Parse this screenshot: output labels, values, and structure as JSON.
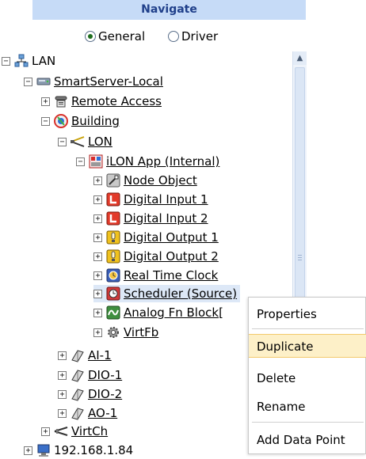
{
  "header": {
    "title": "Navigate"
  },
  "mode": {
    "options": [
      "General",
      "Driver"
    ],
    "selected": "General"
  },
  "tree": [
    {
      "label": "LAN",
      "toggle": "−",
      "icon": "network-icon",
      "underline": false
    },
    {
      "label": "SmartServer-Local",
      "toggle": "−",
      "icon": "server-device-icon",
      "underline": true
    },
    {
      "label": "Remote Access",
      "toggle": "+",
      "icon": "telephone-icon",
      "underline": true
    },
    {
      "label": "Building",
      "toggle": "−",
      "icon": "building-logo-icon",
      "underline": true
    },
    {
      "label": "LON",
      "toggle": "−",
      "icon": "lon-network-icon",
      "underline": true
    },
    {
      "label": "iLON App (Internal)",
      "toggle": "−",
      "icon": "app-icon",
      "underline": true
    },
    {
      "label": "Node Object",
      "toggle": "+",
      "icon": "node-object-icon",
      "underline": true
    },
    {
      "label": "Digital Input 1",
      "toggle": "+",
      "icon": "digital-input-icon",
      "underline": true
    },
    {
      "label": "Digital Input 2",
      "toggle": "+",
      "icon": "digital-input-icon",
      "underline": true
    },
    {
      "label": "Digital Output 1",
      "toggle": "+",
      "icon": "digital-output-icon",
      "underline": true
    },
    {
      "label": "Digital Output 2",
      "toggle": "+",
      "icon": "digital-output-icon",
      "underline": true
    },
    {
      "label": "Real Time Clock",
      "toggle": "+",
      "icon": "clock-icon",
      "underline": true
    },
    {
      "label": "Scheduler (Source)",
      "toggle": "+",
      "icon": "scheduler-icon",
      "underline": true
    },
    {
      "label": "Analog Fn Block[",
      "toggle": "+",
      "icon": "analog-fn-block-icon",
      "underline": true
    },
    {
      "label": "VirtFb",
      "toggle": "+",
      "icon": "gear-icon",
      "underline": true
    },
    {
      "label": "AI-1",
      "toggle": "+",
      "icon": "device-icon",
      "underline": true
    },
    {
      "label": "DIO-1",
      "toggle": "+",
      "icon": "device-icon",
      "underline": true
    },
    {
      "label": "DIO-2",
      "toggle": "+",
      "icon": "device-icon",
      "underline": true
    },
    {
      "label": "AO-1",
      "toggle": "+",
      "icon": "device-icon",
      "underline": true
    },
    {
      "label": "VirtCh",
      "toggle": "+",
      "icon": "virtual-channel-icon",
      "underline": true
    },
    {
      "label": "192.168.1.84",
      "toggle": "+",
      "icon": "computer-icon",
      "underline": false
    }
  ],
  "context_menu": {
    "items": [
      "Properties",
      "Duplicate",
      "Delete",
      "Rename",
      "Add Data Point"
    ],
    "highlighted": "Duplicate"
  },
  "colors": {
    "header_bg": "#c6dbf7",
    "header_text": "#1f3f8a",
    "menu_highlight": "#fdf0c8"
  }
}
